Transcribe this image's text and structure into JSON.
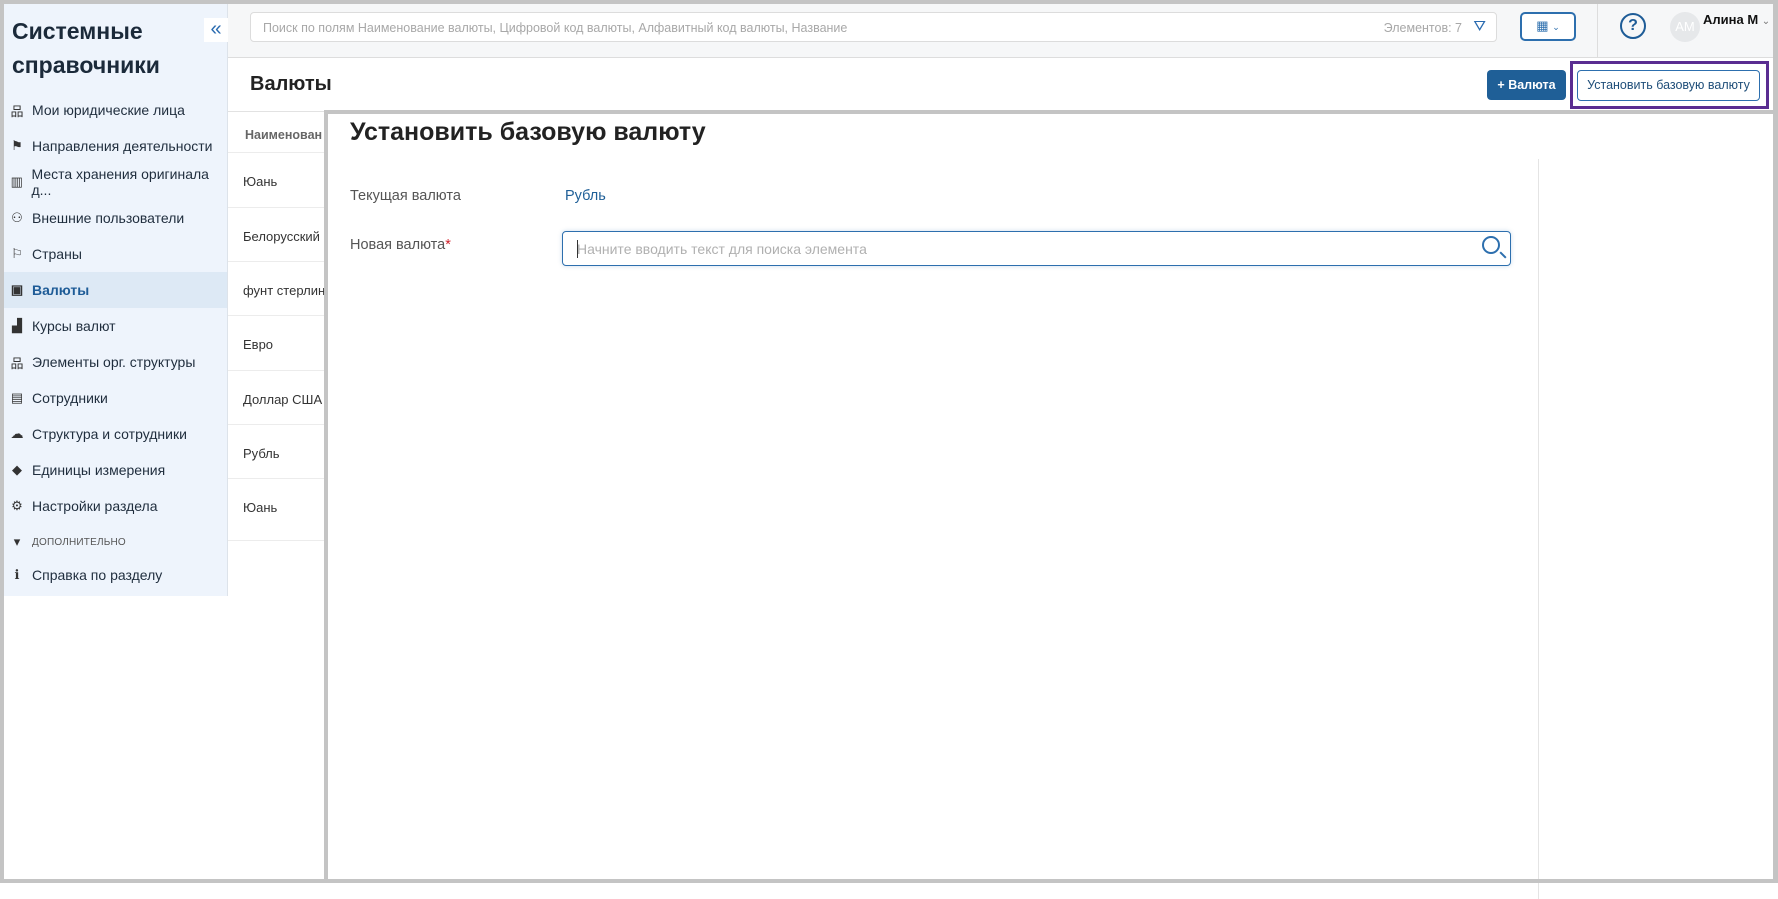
{
  "sidebar": {
    "title_line1": "Системные",
    "title_line2": "справочники",
    "collapse_icon": "«",
    "items": [
      {
        "label": "Мои юридические лица",
        "icon": "org-chart-icon",
        "glyph": "品"
      },
      {
        "label": "Направления деятельности",
        "icon": "signpost-icon",
        "glyph": "⚑"
      },
      {
        "label": "Места хранения оригинала д...",
        "icon": "books-icon",
        "glyph": "▥"
      },
      {
        "label": "Внешние пользователи",
        "icon": "users-icon",
        "glyph": "⚇"
      },
      {
        "label": "Страны",
        "icon": "flag-icon",
        "glyph": "⚐"
      },
      {
        "label": "Валюты",
        "icon": "money-icon",
        "glyph": "▣"
      },
      {
        "label": "Курсы валют",
        "icon": "chart-icon",
        "glyph": "▟"
      },
      {
        "label": "Элементы орг. структуры",
        "icon": "org-chart-icon",
        "glyph": "品"
      },
      {
        "label": "Сотрудники",
        "icon": "id-card-icon",
        "glyph": "▤"
      },
      {
        "label": "Структура и сотрудники",
        "icon": "cloud-icon",
        "glyph": "☁"
      },
      {
        "label": "Единицы измерения",
        "icon": "cube-icon",
        "glyph": "◆"
      },
      {
        "label": "Настройки раздела",
        "icon": "gear-icon",
        "glyph": "⚙"
      }
    ],
    "section": "ДОПОЛНИТЕЛЬНО",
    "help_item": "Справка по разделу"
  },
  "topbar": {
    "search_placeholder": "Поиск по полям Наименование валюты, Цифровой код валюты, Алфавитный код валюты, Название",
    "count": "Элементов: 7",
    "avatar": "АМ",
    "user": "Алина М"
  },
  "page": {
    "title": "Валюты",
    "add_button": "+ Валюта",
    "base_button": "Установить базовую валюту"
  },
  "table": {
    "column": "Наименование валюты",
    "rows": [
      "Юань",
      "Белорусский рубль",
      "фунт стерлингов",
      "Евро",
      "Доллар США",
      "Рубль",
      "Юань"
    ]
  },
  "modal": {
    "title": "Установить базовую валюту",
    "current_label": "Текущая валюта",
    "current_value": "Рубль",
    "new_label": "Новая валюта",
    "required": "*",
    "new_placeholder": "Начните вводить текст для поиска элемента"
  }
}
